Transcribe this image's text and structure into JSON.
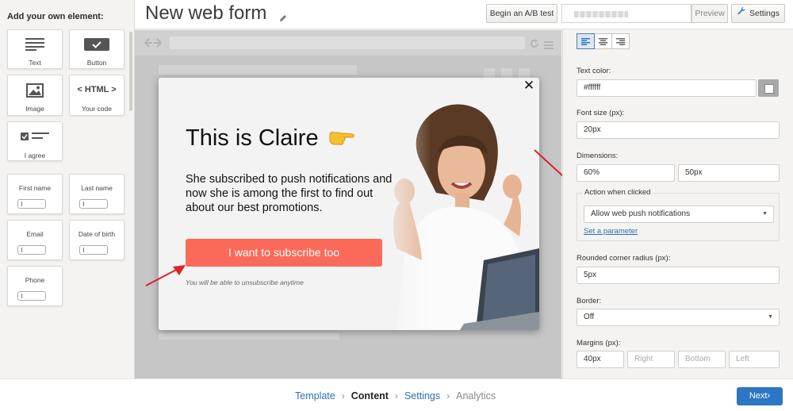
{
  "sidebar": {
    "title": "Add your own element:",
    "elements": [
      {
        "label": "Text",
        "icon": "text-lines-icon"
      },
      {
        "label": "Button",
        "icon": "button-check-icon"
      },
      {
        "label": "Image",
        "icon": "image-icon"
      },
      {
        "label": "Your code",
        "icon": "html-icon",
        "icon_text": "< HTML >"
      },
      {
        "label": "I agree",
        "icon": "checkbox-lines-icon"
      }
    ],
    "fields": [
      "First name",
      "Last name",
      "Email",
      "Date of birth",
      "Phone"
    ]
  },
  "header": {
    "title": "New web form",
    "ab_test_label": "Begin an A/B test",
    "preview_label": "Preview",
    "settings_label": "Settings"
  },
  "popup": {
    "title": "This is Claire",
    "body": "She subscribed to push notifications and now she is among the first to find out about our best promotions.",
    "button_label": "I want to subscribe too",
    "note": "You will be able to unsubscribe anytime",
    "close_glyph": "✕"
  },
  "panel": {
    "text_color_label": "Text color:",
    "text_color_value": "#ffffff",
    "font_size_label": "Font size (px):",
    "font_size_value": "20px",
    "dimensions_label": "Dimensions:",
    "width_value": "60%",
    "height_value": "50px",
    "action_label": "Action when clicked",
    "action_value": "Allow web push notifications",
    "set_parameter_label": "Set a parameter",
    "radius_label": "Rounded corner radius (px):",
    "radius_value": "5px",
    "border_label": "Border:",
    "border_value": "Off",
    "margins_label": "Margins (px):",
    "margin_top_value": "40px",
    "margin_right_placeholder": "Right",
    "margin_bottom_placeholder": "Bottom",
    "margin_left_placeholder": "Left"
  },
  "footer": {
    "steps": [
      "Template",
      "Content",
      "Settings",
      "Analytics"
    ],
    "next_label": "Next"
  },
  "colors": {
    "accent": "#2d76c6",
    "subscribe_button": "#fb6a58",
    "arrow": "#e0202a"
  }
}
